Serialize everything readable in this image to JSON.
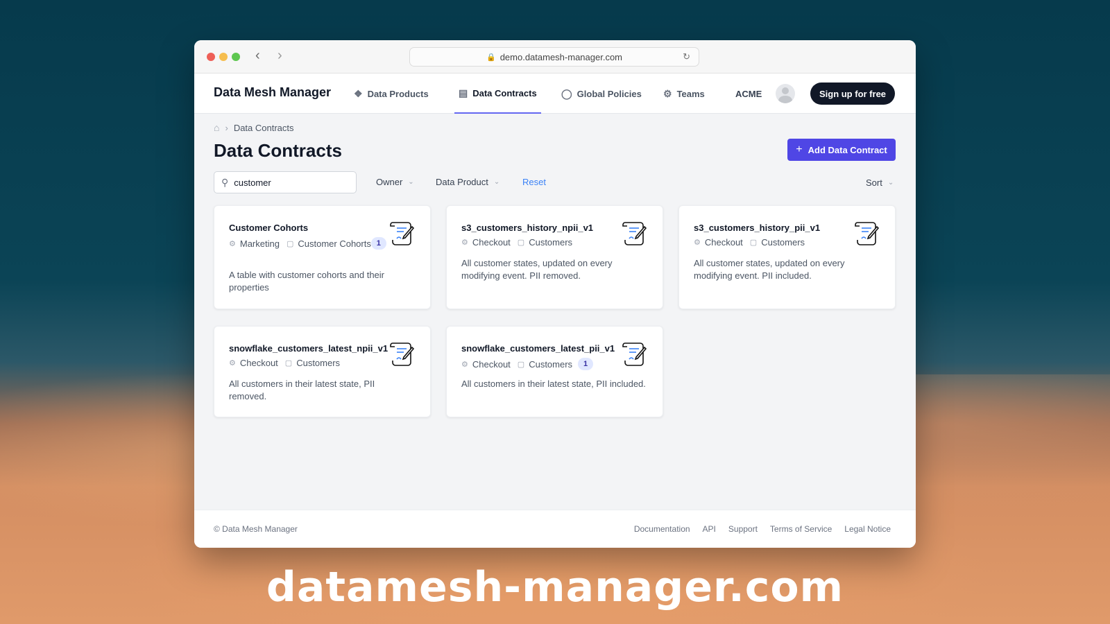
{
  "browser": {
    "url": "demo.datamesh-manager.com"
  },
  "header": {
    "brand": "Data Mesh Manager",
    "nav": [
      {
        "label": "Data Products",
        "icon": "cubes-icon"
      },
      {
        "label": "Data Contracts",
        "icon": "document-icon",
        "active": true
      },
      {
        "label": "Global Policies",
        "icon": "shield-icon"
      },
      {
        "label": "Teams",
        "icon": "users-icon"
      }
    ],
    "organization": "ACME",
    "signup_label": "Sign up for free"
  },
  "breadcrumb": {
    "current": "Data Contracts"
  },
  "page": {
    "title": "Data Contracts",
    "add_button": "Add Data Contract"
  },
  "filters": {
    "search_value": "customer",
    "owner_label": "Owner",
    "data_product_label": "Data Product",
    "reset_label": "Reset",
    "sort_label": "Sort"
  },
  "contracts": [
    {
      "title": "Customer Cohorts",
      "team": "Marketing",
      "data_product": "Customer Cohorts",
      "badge": "1",
      "description": "A table with customer cohorts and their properties"
    },
    {
      "title": "s3_customers_history_npii_v1",
      "team": "Checkout",
      "data_product": "Customers",
      "badge": "",
      "description": "All customer states, updated on every modifying event. PII removed."
    },
    {
      "title": "s3_customers_history_pii_v1",
      "team": "Checkout",
      "data_product": "Customers",
      "badge": "",
      "description": "All customer states, updated on every modifying event. PII included."
    },
    {
      "title": "snowflake_customers_latest_npii_v1",
      "team": "Checkout",
      "data_product": "Customers",
      "badge": "",
      "description": "All customers in their latest state, PII removed."
    },
    {
      "title": "snowflake_customers_latest_pii_v1",
      "team": "Checkout",
      "data_product": "Customers",
      "badge": "1",
      "description": "All customers in their latest state, PII included."
    }
  ],
  "footer": {
    "copyright": "© Data Mesh Manager",
    "links": [
      "Documentation",
      "API",
      "Support",
      "Terms of Service",
      "Legal Notice"
    ]
  },
  "overlay_text": "datamesh-manager.com",
  "colors": {
    "accent": "#4f46e5",
    "dark_button": "#111827",
    "link": "#3b82f6"
  }
}
